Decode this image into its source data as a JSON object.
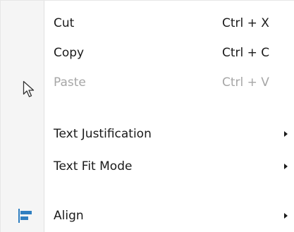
{
  "menu": {
    "items": [
      {
        "label": "Cut",
        "shortcut": "Ctrl + X",
        "enabled": true
      },
      {
        "label": "Copy",
        "shortcut": "Ctrl + C",
        "enabled": true
      },
      {
        "label": "Paste",
        "shortcut": "Ctrl + V",
        "enabled": false
      },
      {
        "label": "Text Justification",
        "submenu": true,
        "enabled": true
      },
      {
        "label": "Text Fit Mode",
        "submenu": true,
        "enabled": true
      },
      {
        "label": "Align",
        "submenu": true,
        "enabled": true,
        "icon": "align-left-icon"
      }
    ]
  },
  "cursor": {
    "icon": "mouse-pointer-icon"
  },
  "colors": {
    "text": "#1a1a1a",
    "disabled_text": "#a6a6a6",
    "align_icon": "#2f7fc1"
  }
}
